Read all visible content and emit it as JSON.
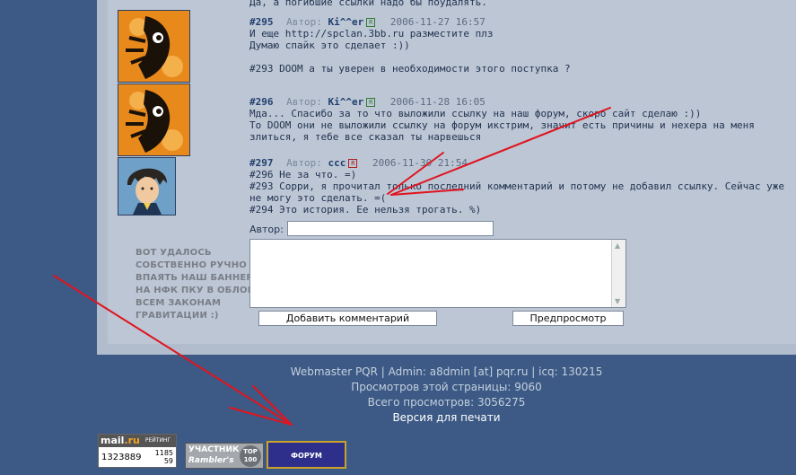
{
  "top_partial_text": "Да, а погибшие ссылки надо бы поудалять.",
  "posts": [
    {
      "number": "#295",
      "author_label": "Автор:",
      "author": "Ki^^er",
      "badge": "R",
      "date": "2006-11-27 16:57",
      "lines": [
        "И еще http://spclan.3bb.ru разместите плз",
        "Думаю спайк это сделает :))",
        "",
        "#293 DOOM а ты уверен в необходимости этого поступка ?"
      ]
    },
    {
      "number": "#296",
      "author_label": "Автор:",
      "author": "Ki^^er",
      "badge": "R",
      "date": "2006-11-28 16:05",
      "lines": [
        "Мда... Спасибо за то что выложили ссылку на наш форум, скоро сайт сделаю :))",
        "То DOOM они не выложили ссылку на форум икстрим, значит есть причины и нехера на меня",
        "злиться, я тебе все сказал ты нарвешься"
      ]
    },
    {
      "number": "#297",
      "author_label": "Автор:",
      "author": "ccc",
      "badge": "R",
      "date": "2006-11-30 21:54",
      "lines": [
        "#296 Не за что. =)",
        "#293 Сорри, я прочитал только последний комментарий и потому не добавил ссылку. Сейчас уже",
        "не могу это сделать. =(",
        "#294 Это история. Ее нельзя трогать. %)"
      ]
    }
  ],
  "side_note": [
    "ВОТ УДАЛОСЬ",
    "СОБСТВЕННО РУЧНО",
    "ВПАЯТЬ НАШ БАННЕР",
    "НА НФК ПКУ В ОБЛОМ",
    "ВСЕМ ЗАКОНАМ",
    "ГРАВИТАЦИИ :)"
  ],
  "form": {
    "author_label": "Автор:",
    "author_value": "",
    "comment_value": "",
    "submit_label": "Добавить комментарий",
    "preview_label": "Предпросмотр"
  },
  "footer": {
    "line1": "Webmaster PQR | Admin: a8dmin [at] pqr.ru | icq: 130215",
    "line2": "Просмотров этой страницы: 9060",
    "line3": "Всего просмотров: 3056275",
    "print_link": "Версия для печати"
  },
  "banners": {
    "mail": {
      "brand": "mail",
      "brand_ru": ".ru",
      "tag": "РЕЙТИНГ",
      "count": "1323889",
      "r1": "1185",
      "r2": "59"
    },
    "rambler": {
      "line1": "УЧАСТНИК",
      "line2": "Rambler's",
      "badge": "TOP 100"
    },
    "forum": {
      "label": "ФОРУМ"
    }
  },
  "colors": {
    "page_bg": "#3c5a85",
    "panel_bg": "#bcc6d5",
    "link": "#21406d",
    "arrow": "#e0141e"
  }
}
